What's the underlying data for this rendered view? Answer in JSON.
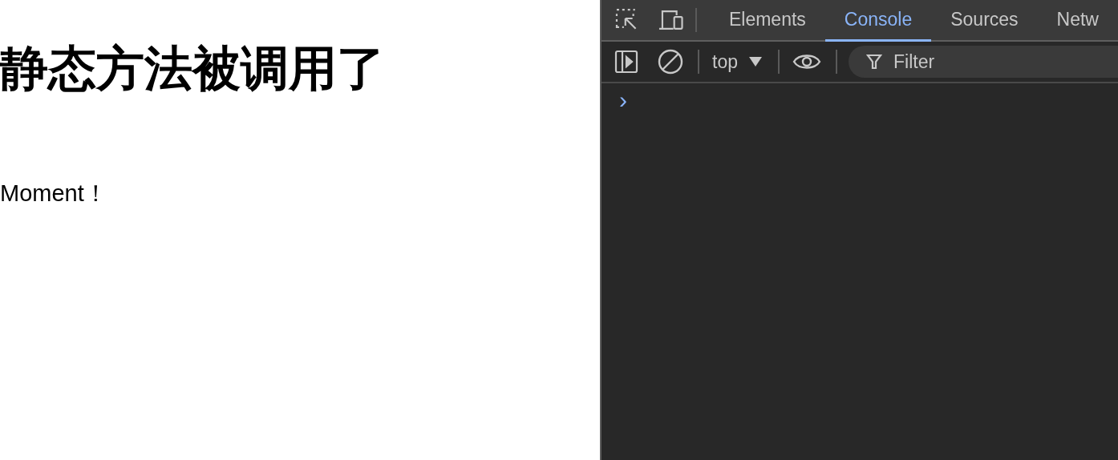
{
  "page": {
    "heading": "静态方法被调用了",
    "paragraph": "Moment！"
  },
  "devtools": {
    "tabs": [
      {
        "label": "Elements",
        "selected": false
      },
      {
        "label": "Console",
        "selected": true
      },
      {
        "label": "Sources",
        "selected": false
      },
      {
        "label": "Netw",
        "selected": false
      }
    ],
    "context": "top",
    "filter": {
      "placeholder": "Filter"
    },
    "prompt": "›"
  }
}
